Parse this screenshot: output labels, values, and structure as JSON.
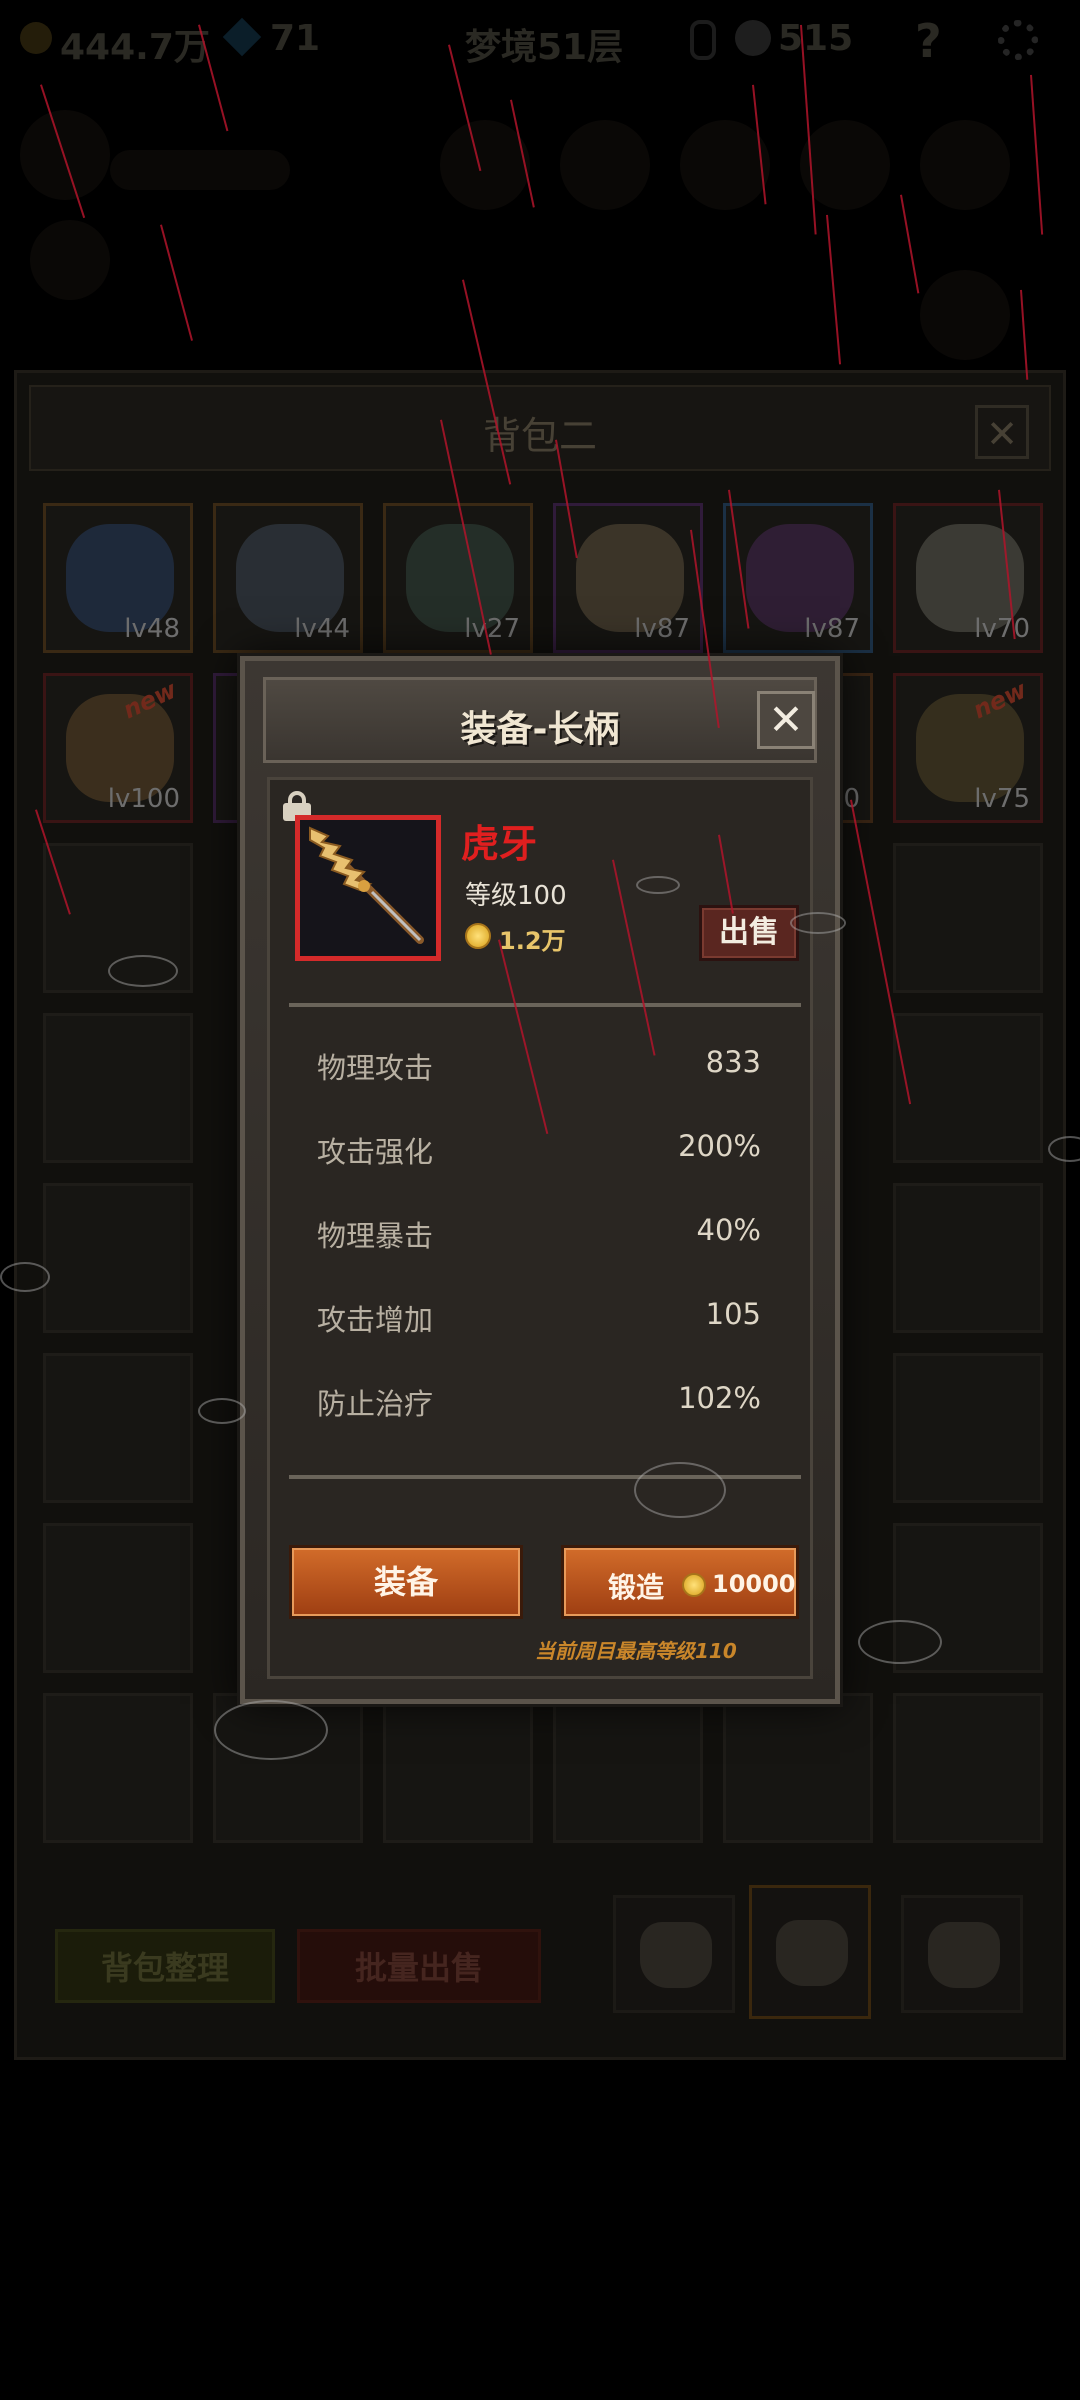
{
  "hud": {
    "gold": "444.7万",
    "gems": "71",
    "floor": "梦境51层",
    "skulls": "515",
    "help": "?"
  },
  "backpack": {
    "title": "背包二",
    "close": "✕",
    "row1": [
      {
        "level": "lv48",
        "color": "#3a5a8a"
      },
      {
        "level": "lv44",
        "color": "#5a6a7a"
      },
      {
        "level": "lv27",
        "color": "#4a6a5a"
      },
      {
        "level": "lv87",
        "color": "#8a7a5a"
      },
      {
        "level": "lv87",
        "color": "#6a3a7a"
      },
      {
        "level": "lv70",
        "color": "#8a8a7a"
      }
    ],
    "row2": [
      {
        "level": "lv100",
        "color": "#8a6a3a",
        "tag": "new"
      },
      {
        "level": "",
        "color": "#3a2a4a"
      },
      {
        "level": "",
        "color": ""
      },
      {
        "level": "",
        "color": ""
      },
      {
        "level": "0",
        "color": "#5a3a2a"
      },
      {
        "level": "lv75",
        "color": "#7a6a3a",
        "tag": "new"
      }
    ],
    "sort_label": "背包整理",
    "bulk_sell_label": "批量出售"
  },
  "dialog": {
    "title": "装备-长柄",
    "close": "✕",
    "item": {
      "name": "虎牙",
      "level": "等级100",
      "price": "1.2万",
      "sell_label": "出售"
    },
    "stats": [
      {
        "label": "物理攻击",
        "value": "833"
      },
      {
        "label": "攻击强化",
        "value": "200%"
      },
      {
        "label": "物理暴击",
        "value": "40%"
      },
      {
        "label": "攻击增加",
        "value": "105"
      },
      {
        "label": "防止治疗",
        "value": "102%"
      }
    ],
    "equip_label": "装备",
    "forge_label": "锻造",
    "forge_cost": "10000",
    "max_level_note": "当前周目最高等级110"
  },
  "colors": {
    "rarity_red": "#d42a2a",
    "item_name": "#e01f1f",
    "button_orange": "#c65a20",
    "price_gold": "#e8c56a"
  }
}
